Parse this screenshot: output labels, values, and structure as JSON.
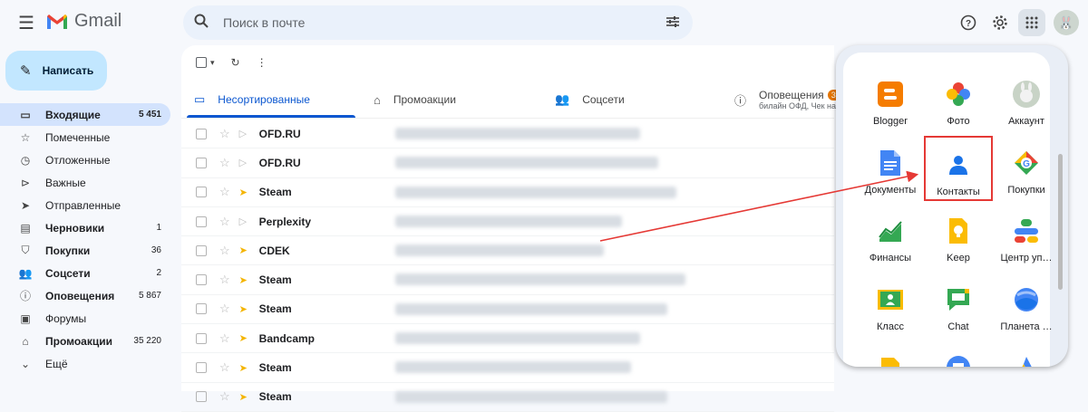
{
  "header": {
    "app_name": "Gmail",
    "search_placeholder": "Поиск в почте",
    "menu_icon": "hamburger-icon",
    "icons": [
      "help-icon",
      "settings-icon",
      "apps-grid-icon",
      "avatar"
    ]
  },
  "compose": {
    "label": "Написать"
  },
  "sidebar": {
    "items": [
      {
        "label": "Входящие",
        "count": "5 451",
        "icon": "inbox-icon",
        "active": true,
        "bold": true
      },
      {
        "label": "Помеченные",
        "count": "",
        "icon": "star-icon",
        "active": false,
        "bold": false
      },
      {
        "label": "Отложенные",
        "count": "",
        "icon": "clock-icon",
        "active": false,
        "bold": false
      },
      {
        "label": "Важные",
        "count": "",
        "icon": "important-icon",
        "active": false,
        "bold": false
      },
      {
        "label": "Отправленные",
        "count": "",
        "icon": "send-icon",
        "active": false,
        "bold": false
      },
      {
        "label": "Черновики",
        "count": "1",
        "icon": "draft-icon",
        "active": false,
        "bold": true
      },
      {
        "label": "Покупки",
        "count": "36",
        "icon": "shopping-icon",
        "active": false,
        "bold": true
      },
      {
        "label": "Соцсети",
        "count": "2",
        "icon": "people-icon",
        "active": false,
        "bold": true
      },
      {
        "label": "Оповещения",
        "count": "5 867",
        "icon": "info-icon",
        "active": false,
        "bold": true
      },
      {
        "label": "Форумы",
        "count": "",
        "icon": "forum-icon",
        "active": false,
        "bold": false
      },
      {
        "label": "Промоакции",
        "count": "35 220",
        "icon": "tag-icon",
        "active": false,
        "bold": true
      },
      {
        "label": "Ещё",
        "count": "",
        "icon": "chevron-down-icon",
        "active": false,
        "bold": false
      }
    ]
  },
  "tabs": [
    {
      "label": "Несортированные",
      "icon": "inbox-icon",
      "active": true
    },
    {
      "label": "Промоакции",
      "icon": "tag-icon",
      "active": false
    },
    {
      "label": "Соцсети",
      "icon": "people-icon",
      "active": false
    },
    {
      "label": "Оповещения",
      "icon": "info-icon",
      "active": false,
      "badge": "39",
      "sub": "билайн ОФД, Чек на"
    }
  ],
  "emails": [
    {
      "sender": "OFD.RU",
      "important": false
    },
    {
      "sender": "OFD.RU",
      "important": false
    },
    {
      "sender": "Steam",
      "important": true
    },
    {
      "sender": "Perplexity",
      "important": false
    },
    {
      "sender": "CDEK",
      "important": true
    },
    {
      "sender": "Steam",
      "important": true
    },
    {
      "sender": "Steam",
      "important": true
    },
    {
      "sender": "Bandcamp",
      "important": true
    },
    {
      "sender": "Steam",
      "important": true
    },
    {
      "sender": "Steam",
      "important": true
    }
  ],
  "apps": [
    {
      "label": "Blogger",
      "icon": "blogger-icon"
    },
    {
      "label": "Фото",
      "icon": "photos-icon"
    },
    {
      "label": "Аккаунт",
      "icon": "account-icon"
    },
    {
      "label": "Документы",
      "icon": "docs-icon"
    },
    {
      "label": "Контакты",
      "icon": "contacts-icon",
      "highlighted": true
    },
    {
      "label": "Покупки",
      "icon": "shopping-icon"
    },
    {
      "label": "Финансы",
      "icon": "finance-icon"
    },
    {
      "label": "Keep",
      "icon": "keep-icon"
    },
    {
      "label": "Центр уп…",
      "icon": "admin-icon"
    },
    {
      "label": "Класс",
      "icon": "classroom-icon"
    },
    {
      "label": "Chat",
      "icon": "chat-icon"
    },
    {
      "label": "Планета …",
      "icon": "earth-icon"
    },
    {
      "label": "",
      "icon": "sites-icon"
    },
    {
      "label": "",
      "icon": "arts-icon"
    },
    {
      "label": "",
      "icon": "ads-icon"
    }
  ],
  "colors": {
    "accent": "#0b57d0",
    "compose_bg": "#c2e7ff",
    "highlight": "#e53935"
  }
}
